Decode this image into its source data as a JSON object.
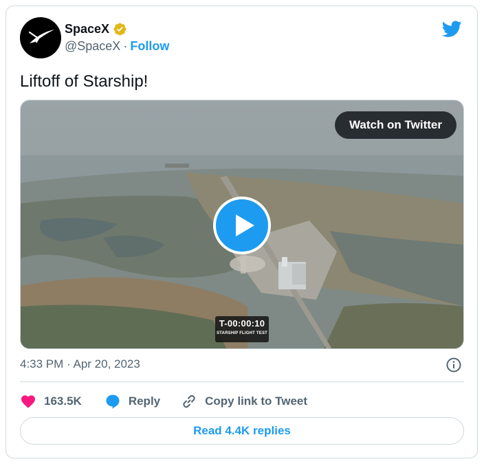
{
  "author": {
    "display_name": "SpaceX",
    "handle": "@SpaceX",
    "separator": "·",
    "follow_label": "Follow"
  },
  "tweet": {
    "text": "Liftoff of Starship!",
    "timestamp": "4:33 PM · Apr 20, 2023"
  },
  "media": {
    "watch_label": "Watch on Twitter",
    "overlay_time": "T-00:00:10",
    "overlay_caption": "STARSHIP FLIGHT TEST"
  },
  "actions": {
    "like_count": "163.5K",
    "reply_label": "Reply",
    "copy_link_label": "Copy link to Tweet",
    "read_replies_label": "Read 4.4K replies"
  },
  "colors": {
    "accent": "#1d9bf0",
    "like": "#f91880",
    "verified": "#e2b719",
    "text_secondary": "#536471",
    "border": "#cfd9de"
  },
  "icons": [
    "spacex-logo-icon",
    "verified-badge-icon",
    "twitter-bird-icon",
    "play-icon",
    "info-icon",
    "heart-icon",
    "reply-bubble-icon",
    "link-icon"
  ]
}
